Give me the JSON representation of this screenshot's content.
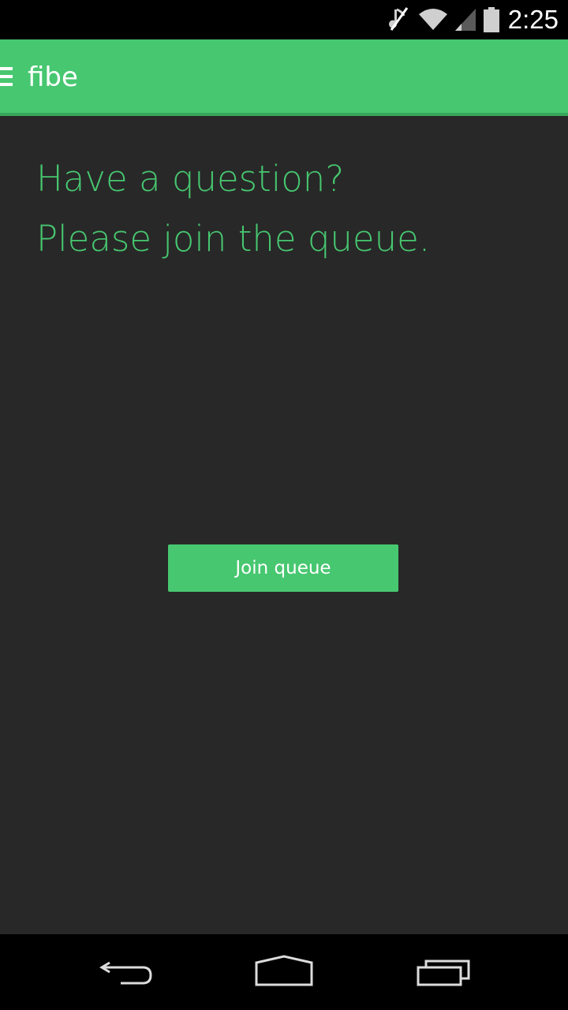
{
  "status_bar": {
    "time": "2:25",
    "icons": [
      "mute-icon",
      "wifi-icon",
      "signal-icon",
      "battery-icon"
    ]
  },
  "app_bar": {
    "title": "fibe",
    "menu_icon": "hamburger-menu-icon",
    "color": "#47c770"
  },
  "main": {
    "headline_1": "Have a question?",
    "headline_2": "Please join the queue.",
    "join_button_label": "Join queue",
    "accent_color": "#47c770",
    "background_color": "#282828"
  },
  "nav_bar": {
    "icons": [
      "back-icon",
      "home-icon",
      "recents-icon"
    ]
  }
}
